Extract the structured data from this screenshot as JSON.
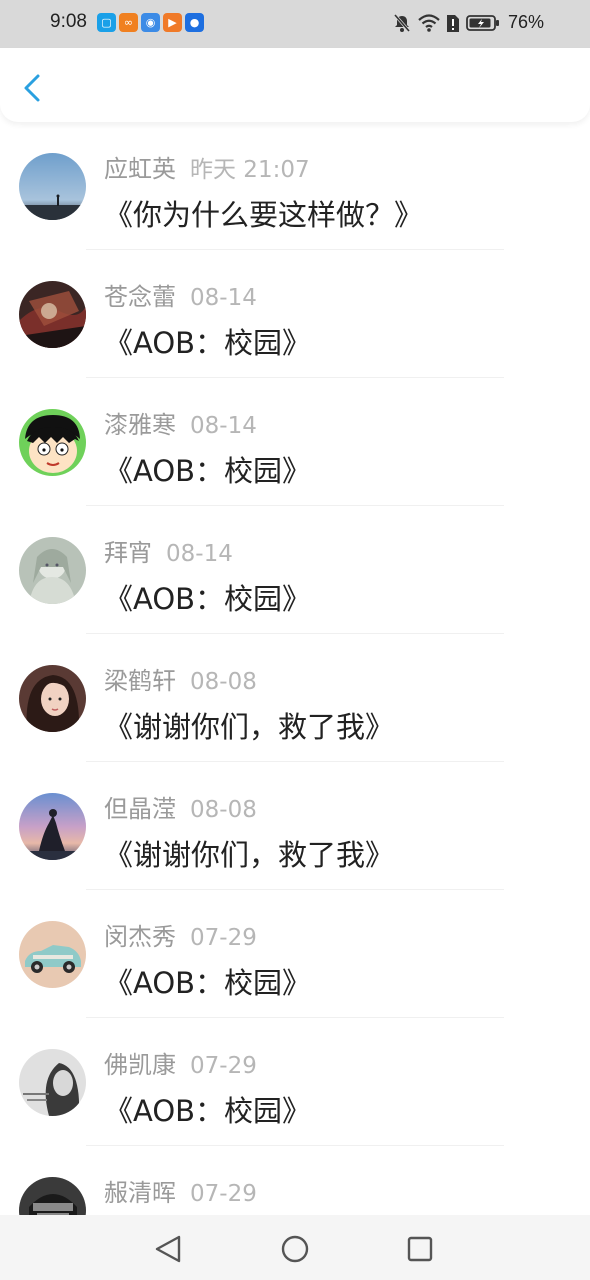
{
  "status_bar": {
    "time": "9:08",
    "battery": "76%",
    "app_icons": [
      {
        "name": "book-app-icon",
        "color": "#1aa0e8",
        "glyph": "▢"
      },
      {
        "name": "video-app-icon",
        "color": "#f08020",
        "glyph": "∞"
      },
      {
        "name": "browser-app-icon",
        "color": "#3c8be6",
        "glyph": "◉"
      },
      {
        "name": "play-app-icon",
        "color": "#f07a28",
        "glyph": "▶"
      },
      {
        "name": "bulb-app-icon",
        "color": "#1e6fe0",
        "glyph": "●"
      }
    ]
  },
  "header": {
    "back_icon": "chevron-left-icon",
    "accent": "#2aa0e0"
  },
  "items": [
    {
      "name": "应虹英",
      "time": "昨天 21:07",
      "title": "《你为什么要这样做？》",
      "avatar": "sky-silhouette"
    },
    {
      "name": "苍念蕾",
      "time": "08-14",
      "title": "《AOB：校园》",
      "avatar": "dark-red-art"
    },
    {
      "name": "漆雅寒",
      "time": "08-14",
      "title": "《AOB：校园》",
      "avatar": "cartoon-girl"
    },
    {
      "name": "拜宵",
      "time": "08-14",
      "title": "《AOB：校园》",
      "avatar": "pale-anime"
    },
    {
      "name": "梁鹤轩",
      "time": "08-08",
      "title": "《谢谢你们，救了我》",
      "avatar": "girl-portrait"
    },
    {
      "name": "但晶滢",
      "time": "08-08",
      "title": "《谢谢你们，救了我》",
      "avatar": "sunset-yoga"
    },
    {
      "name": "闵杰秀",
      "time": "07-29",
      "title": "《AOB：校园》",
      "avatar": "vintage-car"
    },
    {
      "name": "佛凯康",
      "time": "07-29",
      "title": "《AOB：校园》",
      "avatar": "bw-girl"
    },
    {
      "name": "赧清晖",
      "time": "07-29",
      "title": "",
      "avatar": "dark-photo"
    }
  ]
}
